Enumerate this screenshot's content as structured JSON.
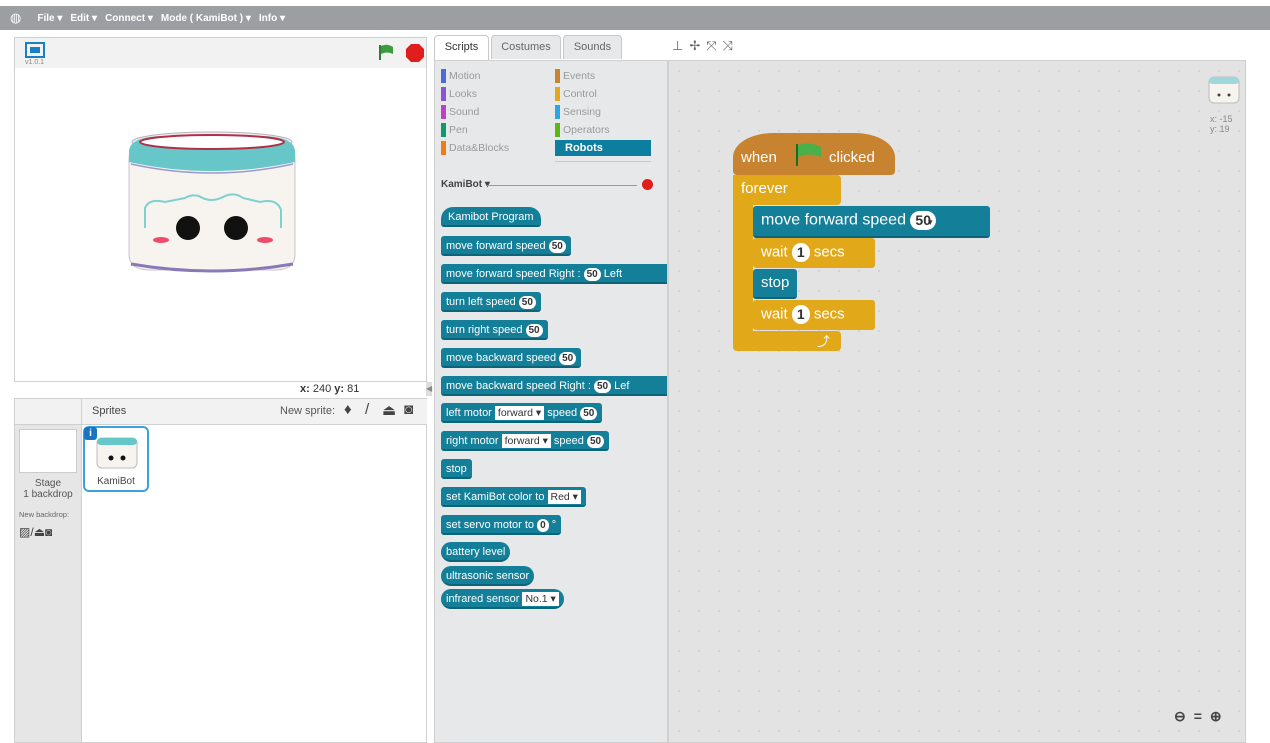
{
  "menu": {
    "file": "File ▾",
    "edit": "Edit ▾",
    "connect": "Connect ▾",
    "mode": "Mode ( KamiBot ) ▾",
    "info": "Info ▾"
  },
  "stage": {
    "version": "v1.0.1",
    "coords_x_label": "x:",
    "coords_x": "240",
    "coords_y_label": "y:",
    "coords_y": "81"
  },
  "sprites": {
    "header": "Sprites",
    "new_sprite": "New sprite:",
    "stage_label": "Stage",
    "backdrop_count": "1 backdrop",
    "new_backdrop": "New backdrop:",
    "sprite_name": "KamiBot"
  },
  "tabs": {
    "scripts": "Scripts",
    "costumes": "Costumes",
    "sounds": "Sounds"
  },
  "categories": {
    "motion": "Motion",
    "looks": "Looks",
    "sound": "Sound",
    "pen": "Pen",
    "data": "Data&Blocks",
    "events": "Events",
    "control": "Control",
    "sensing": "Sensing",
    "operators": "Operators",
    "robots": "Robots"
  },
  "category_colors": {
    "motion": "#4a6cd4",
    "looks": "#8a55d7",
    "sound": "#bb42c3",
    "pen": "#0e9a6c",
    "data": "#ee7d16",
    "events": "#c88330",
    "control": "#e1a91a",
    "sensing": "#2ca5e2",
    "operators": "#5cb712",
    "robots": "#0e7ea0"
  },
  "palette": {
    "device": "KamiBot ▾",
    "program": "Kamibot Program",
    "fwd": "move forward speed",
    "fwd_val": "50",
    "fwdrl": "move forward speed Right :",
    "fwdrl_val": "50",
    "fwdrl_left": "Left",
    "tleft": "turn left speed",
    "tleft_val": "50",
    "tright": "turn right speed",
    "tright_val": "50",
    "back": "move backward speed",
    "back_val": "50",
    "backrl": "move backward speed Right :",
    "backrl_val": "50",
    "backrl_left": "Lef",
    "lmotor": "left motor",
    "lmotor_dir": "forward",
    "lmotor_speed": "speed",
    "lmotor_val": "50",
    "rmotor": "right motor",
    "rmotor_dir": "forward",
    "rmotor_speed": "speed",
    "rmotor_val": "50",
    "stop": "stop",
    "color": "set KamiBot color to",
    "color_val": "Red",
    "servo": "set servo motor to",
    "servo_val": "0",
    "servo_unit": "°",
    "battery": "battery level",
    "ultra": "ultrasonic sensor",
    "infrared": "infrared sensor",
    "infrared_val": "No.1"
  },
  "script": {
    "when": "when",
    "clicked": "clicked",
    "forever": "forever",
    "move": "move forward  speed",
    "move_val": "50",
    "wait1": "wait",
    "wait1_val": "1",
    "wait1_unit": "secs",
    "stop": "stop",
    "wait2": "wait",
    "wait2_val": "1",
    "wait2_unit": "secs",
    "sprite_x": "x: -15",
    "sprite_y": "y: 19"
  }
}
